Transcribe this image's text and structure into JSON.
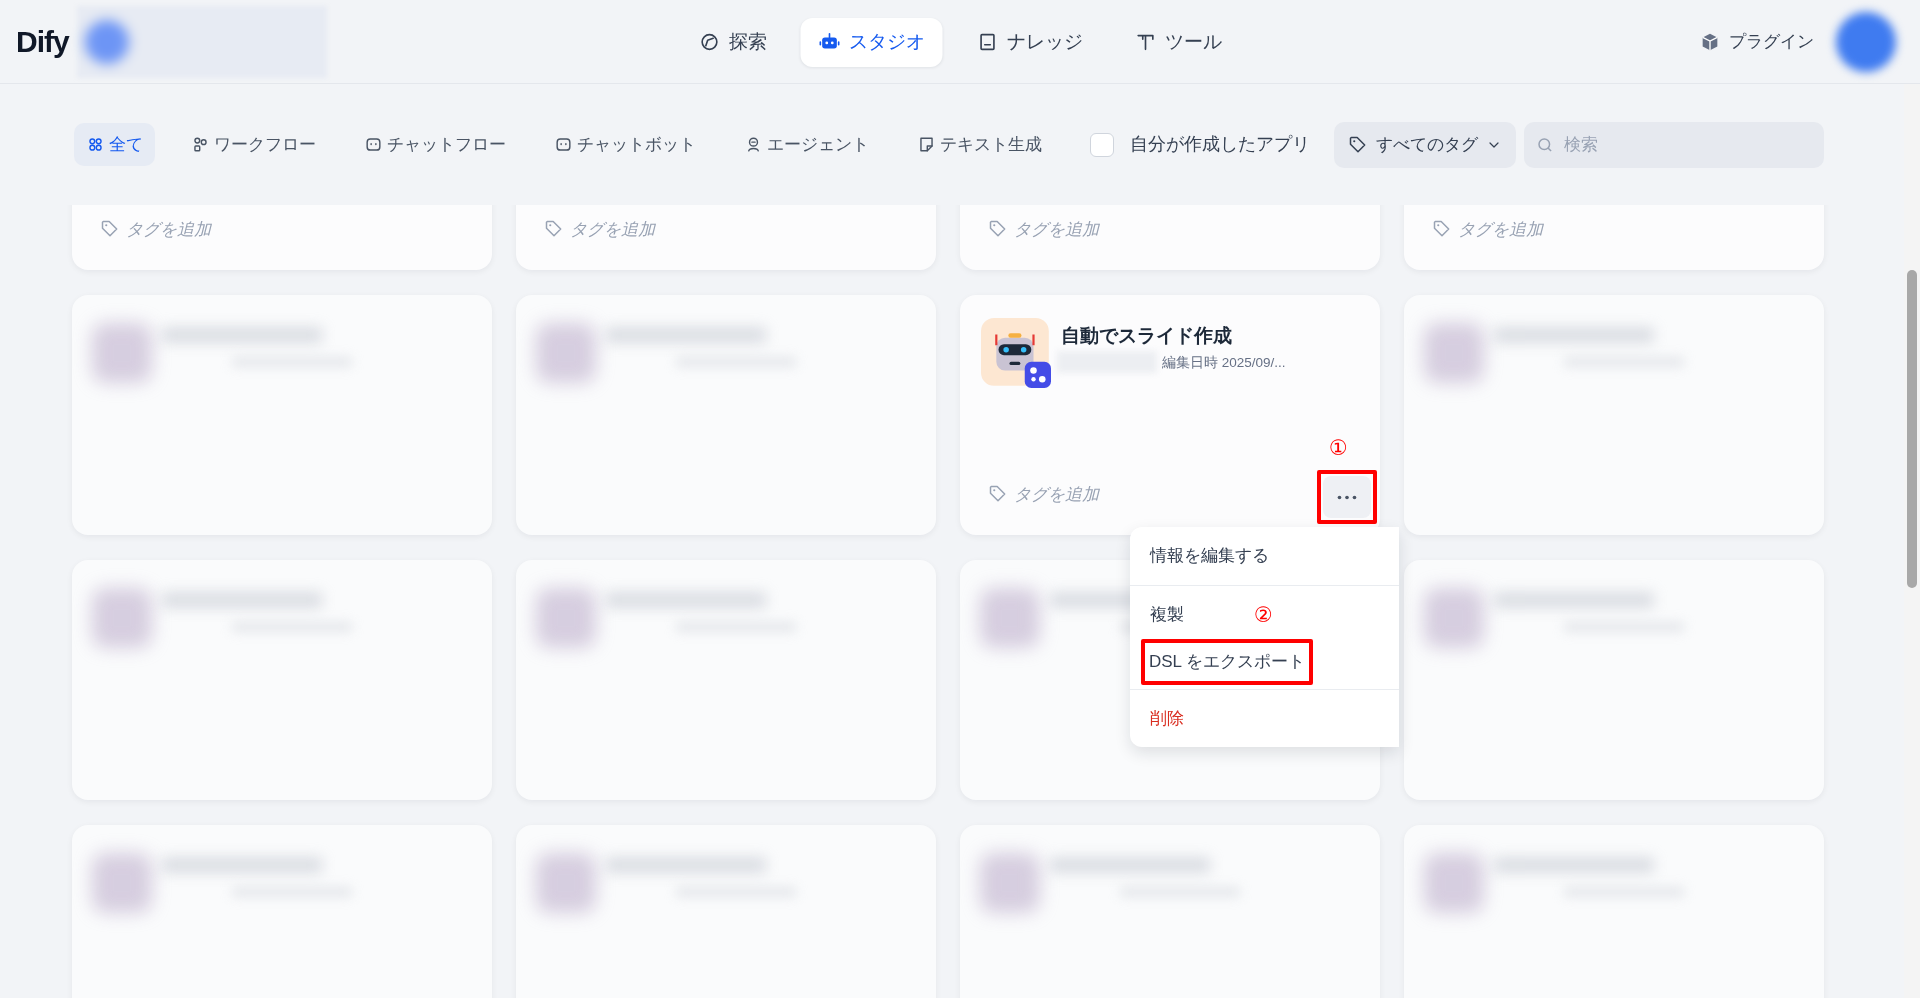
{
  "header": {
    "logo": "Dify",
    "nav": [
      {
        "label": "探索",
        "selected": false
      },
      {
        "label": "スタジオ",
        "selected": true
      },
      {
        "label": "ナレッジ",
        "selected": false
      },
      {
        "label": "ツール",
        "selected": false
      }
    ],
    "plugins": "プラグイン"
  },
  "filters": {
    "tabs": [
      {
        "label": "全て",
        "selected": true
      },
      {
        "label": "ワークフロー",
        "selected": false
      },
      {
        "label": "チャットフロー",
        "selected": false
      },
      {
        "label": "チャットボット",
        "selected": false
      },
      {
        "label": "エージェント",
        "selected": false
      },
      {
        "label": "テキスト生成",
        "selected": false
      }
    ],
    "mine": {
      "label": "自分が作成したアプリ",
      "checked": false
    },
    "tag_dropdown": "すべてのタグ",
    "search": {
      "placeholder": "検索"
    }
  },
  "cards": [
    {
      "kind": "tag_only",
      "tag_placeholder": "タグを追加"
    },
    {
      "kind": "tag_only",
      "tag_placeholder": "タグを追加"
    },
    {
      "kind": "tag_only",
      "tag_placeholder": "タグを追加"
    },
    {
      "kind": "tag_only",
      "tag_placeholder": "タグを追加"
    },
    {
      "kind": "blurred"
    },
    {
      "kind": "blurred"
    },
    {
      "kind": "app",
      "title": "自動でスライド作成",
      "edited": "編集日時 2025/09/...",
      "tag_placeholder": "タグを追加",
      "menu_open": true
    },
    {
      "kind": "blurred"
    },
    {
      "kind": "blurred"
    },
    {
      "kind": "blurred"
    },
    {
      "kind": "blurred"
    },
    {
      "kind": "blurred"
    },
    {
      "kind": "blurred"
    },
    {
      "kind": "blurred"
    },
    {
      "kind": "blurred"
    },
    {
      "kind": "blurred"
    }
  ],
  "menu": {
    "items": [
      {
        "label": "情報を編集する",
        "kind": "normal",
        "divider_before": false
      },
      {
        "label": "複製",
        "kind": "normal",
        "divider_before": true
      },
      {
        "label": "DSL をエクスポート",
        "kind": "normal",
        "divider_before": false
      },
      {
        "label": "削除",
        "kind": "danger",
        "divider_before": true
      }
    ]
  },
  "annotations": [
    {
      "label": "①"
    },
    {
      "label": "②"
    }
  ]
}
